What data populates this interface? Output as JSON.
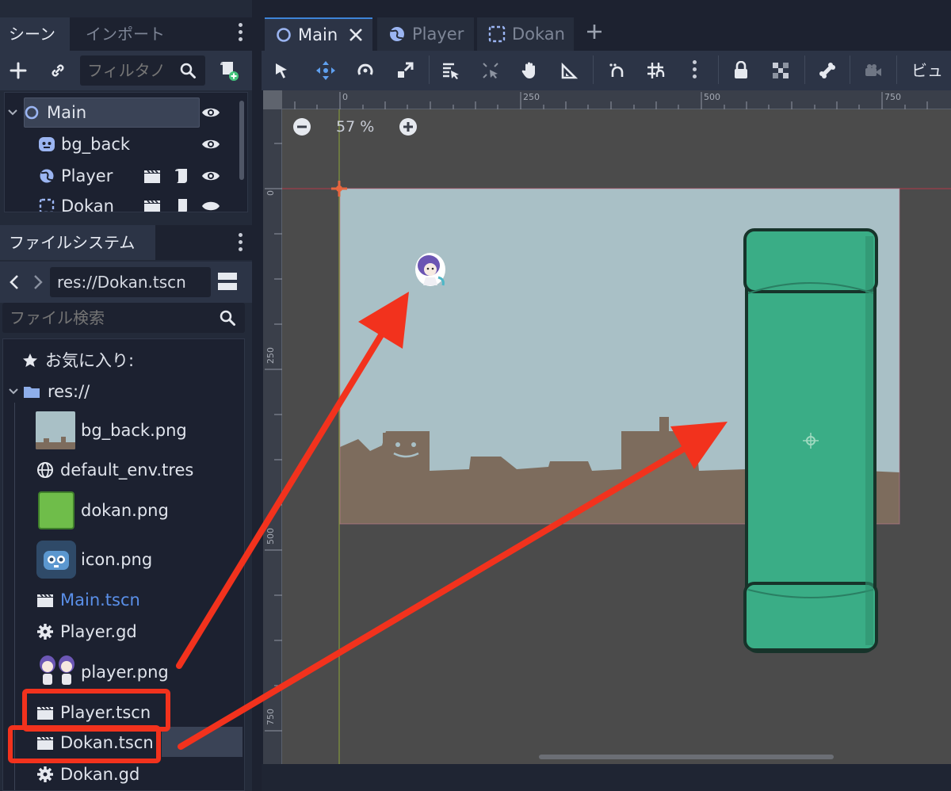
{
  "scene_dock": {
    "tabs": [
      {
        "label": "シーン"
      },
      {
        "label": "インポート"
      }
    ],
    "filter_placeholder": "フィルタノ",
    "tree": [
      {
        "label": "Main",
        "icon": "node2d-circle-icon"
      },
      {
        "label": "bg_back",
        "icon": "sprite-icon"
      },
      {
        "label": "Player",
        "icon": "globe-instance-icon"
      },
      {
        "label": "Dokan",
        "icon": "area-frame-icon"
      }
    ]
  },
  "filesystem_dock": {
    "tab_label": "ファイルシステム",
    "path": "res://Dokan.tscn",
    "search_placeholder": "ファイル検索",
    "favorites_label": "お気に入り:",
    "root_label": "res://",
    "files": [
      {
        "name": "bg_back.png",
        "icon": "image-thumbnail-icon"
      },
      {
        "name": "default_env.tres",
        "icon": "globe-icon"
      },
      {
        "name": "dokan.png",
        "icon": "green-pipe-thumbnail-icon"
      },
      {
        "name": "icon.png",
        "icon": "godot-robot-thumbnail-icon"
      },
      {
        "name": "Main.tscn",
        "icon": "clapper-icon",
        "highlight": true
      },
      {
        "name": "Player.gd",
        "icon": "gear-icon"
      },
      {
        "name": "player.png",
        "icon": "character-thumbnail-icon"
      },
      {
        "name": "Player.tscn",
        "icon": "clapper-icon",
        "boxed": true
      },
      {
        "name": "Dokan.tscn",
        "icon": "clapper-icon",
        "boxed": true,
        "selected": true
      },
      {
        "name": "Dokan.gd",
        "icon": "gear-icon"
      }
    ]
  },
  "editor_tabs": [
    {
      "label": "Main",
      "active": true
    },
    {
      "label": "Player",
      "active": false
    },
    {
      "label": "Dokan",
      "active": false
    }
  ],
  "toolbar": {
    "view_label": "ビュー"
  },
  "viewport": {
    "zoom_label": "57 %",
    "ruler_top_labels": [
      "0",
      "250",
      "500",
      "750"
    ],
    "ruler_left_labels": [
      "0",
      "250",
      "500",
      "750"
    ]
  },
  "colors": {
    "sky": "#a9c0c6",
    "ground": "#7d6c5d",
    "pipe": "#3aad86",
    "annotation_red": "#f2321d",
    "accent_blue": "#5a8fe8"
  }
}
